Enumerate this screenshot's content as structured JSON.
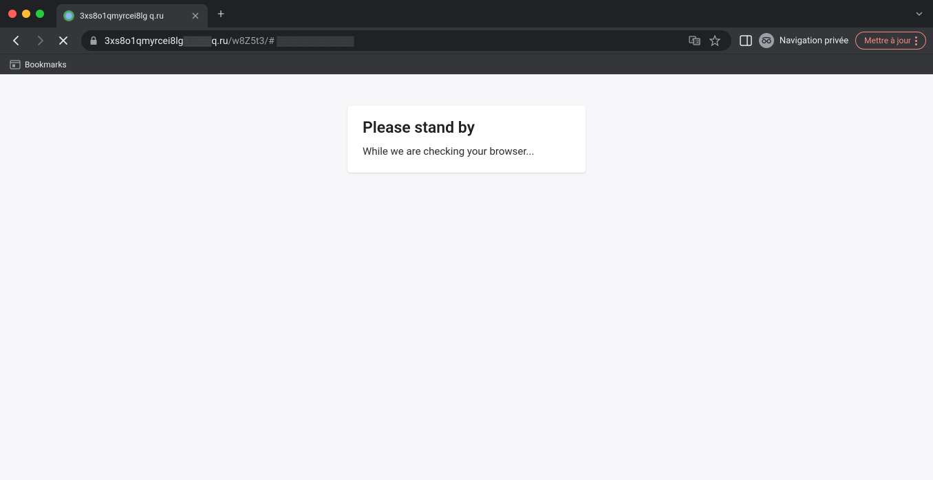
{
  "browser": {
    "tab": {
      "title": "3xs8o1qmyrcei8lg        q.ru"
    },
    "url": {
      "host": "3xs8o1qmyrcei8lg",
      "mid": "q.ru",
      "path": "/w8Z5t3/#"
    },
    "incognito_label": "Navigation privée",
    "update_label": "Mettre à jour",
    "bookmarks_label": "Bookmarks"
  },
  "page": {
    "title": "Please stand by",
    "message": "While we are checking your browser..."
  }
}
